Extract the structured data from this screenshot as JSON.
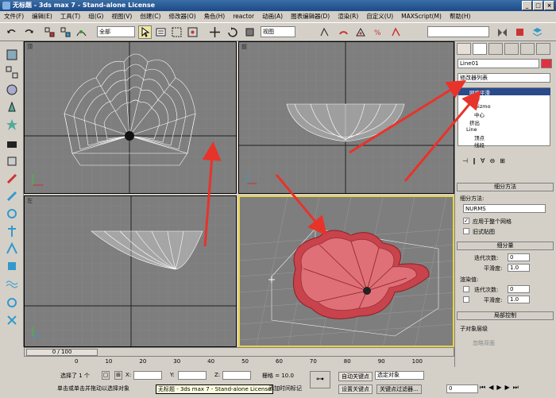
{
  "title": {
    "text": "无标题  - 3ds max 7  - Stand-alone License"
  },
  "menu": [
    "文件(F)",
    "编辑(E)",
    "工具(T)",
    "组(G)",
    "视图(V)",
    "创建(C)",
    "修改器(O)",
    "角色(H)",
    "reactor",
    "动画(A)",
    "图表编辑器(D)",
    "渲染(R)",
    "自定义(U)",
    "MAXScript(M)",
    "帮助(H)"
  ],
  "toolbar": {
    "selection_filter": "全部",
    "ref_coord": "视图"
  },
  "viewports": {
    "top": "顶",
    "front": "前",
    "left": "左",
    "persp": "透视"
  },
  "panel": {
    "object_name": "Line01",
    "modifier_list": "修改器列表",
    "stack": [
      "网格平滑",
      "Taper",
      "Gizmo",
      "中心",
      "挤出",
      "Line",
      "顶点",
      "线段"
    ],
    "rollout_subdiv": "细分方法",
    "subdiv_method_label": "细分方法:",
    "subdiv_method_value": "NURMS",
    "apply_whole": "应用于整个网格",
    "old_map": "旧式贴图",
    "rollout_subdiv_amount": "细分量",
    "iterations_label": "迭代次数:",
    "iterations_value": "0",
    "smoothness_label": "平滑度:",
    "smoothness_value": "1.0",
    "render_values": "渲染值:",
    "r_iterations_label": "迭代次数:",
    "r_iterations_value": "0",
    "r_smoothness_label": "平滑度:",
    "r_smoothness_value": "1.0",
    "rollout_local": "局部控制",
    "sublevel": "子对象层级",
    "ignore_back": "忽略背面"
  },
  "timeline": {
    "frame": "0 / 100",
    "ticks": [
      "0",
      "10",
      "20",
      "30",
      "40",
      "50",
      "60",
      "70",
      "80",
      "90",
      "100"
    ]
  },
  "status": {
    "selected": "选择了 1 个",
    "x_label": "X:",
    "y_label": "Y:",
    "z_label": "Z:",
    "grid": "栅格 = 10.0",
    "auto_key": "自动关键点",
    "select_obj": "选定对象",
    "set_key": "设置关键点",
    "key_filter": "关键点过滤器...",
    "hint": "单击或单击并拖动以选择对象",
    "add_time_tag": "添加时间标记",
    "tooltip": "无标题 - 3ds max 7 - Stand-alone License",
    "frame_value": "0"
  },
  "colors": {
    "arrow": "#e8332b",
    "object_red": "#c8434b",
    "viewport_bg": "#7e7e7e",
    "active_border": "#e8d34a"
  }
}
